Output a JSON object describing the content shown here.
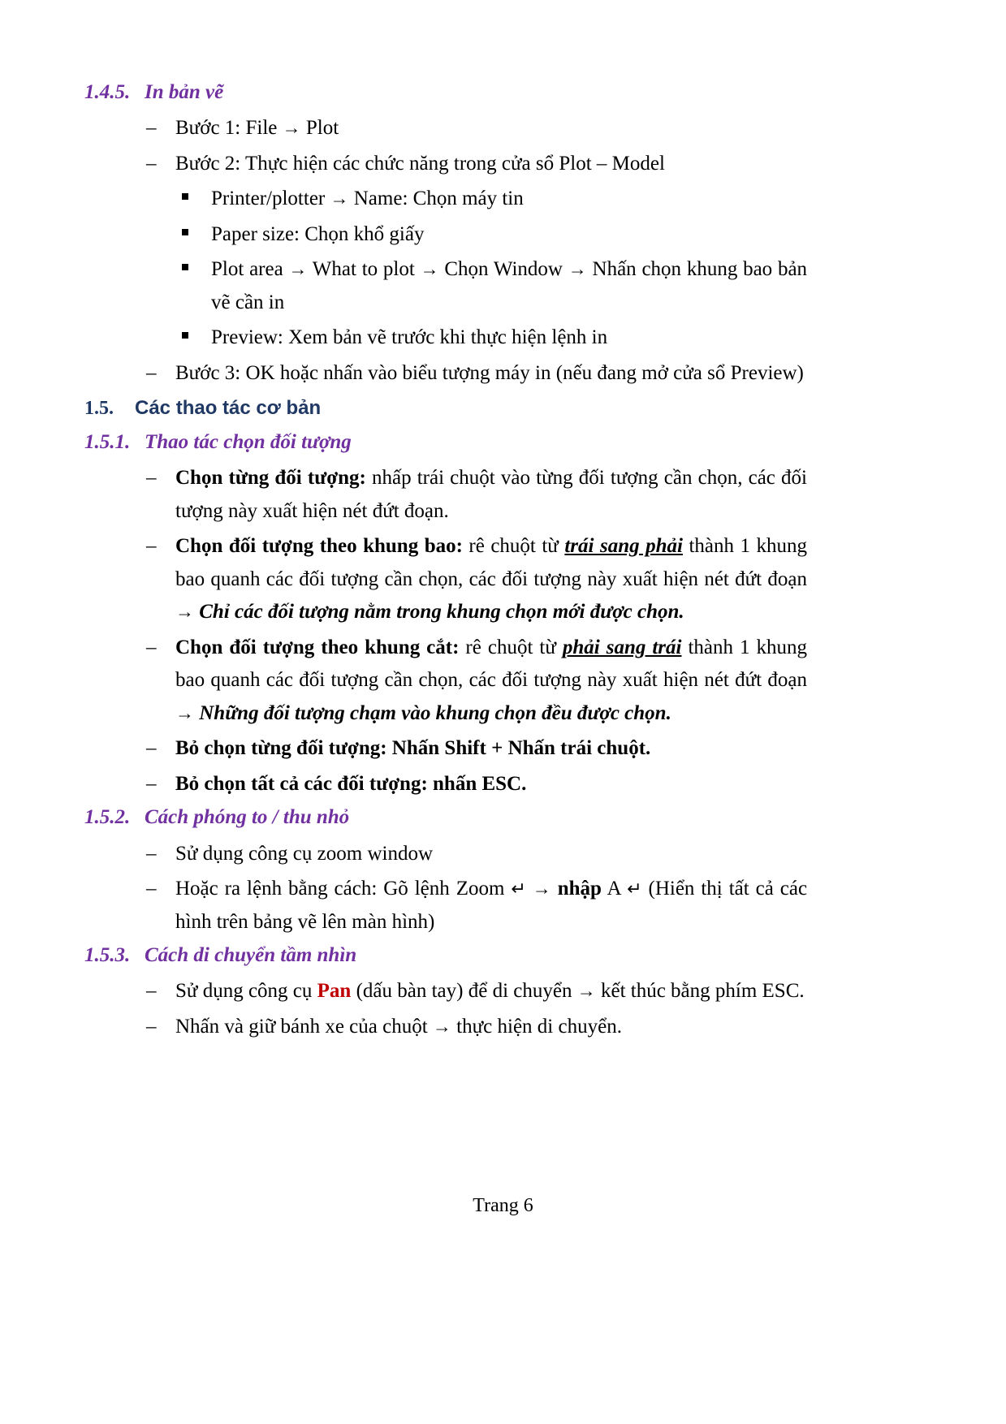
{
  "document": {
    "language": "vi",
    "footer": "Trang 6",
    "colors": {
      "heading3": "#7030A0",
      "heading2": "#1F3864",
      "accent_red": "#C00000",
      "body": "#000000"
    }
  },
  "sections": {
    "s145": {
      "number": "1.4.5.",
      "title": "In bản vẽ",
      "items": {
        "buoc1": {
          "marker": "–",
          "text": "Bước 1: File",
          "arrow": "→",
          "text_after": "Plot"
        },
        "buoc2": {
          "marker": "–",
          "text": "Bước 2: Thực hiện các chức năng trong cửa sổ Plot – Model"
        },
        "sub": [
          {
            "marker": "▪",
            "part1": "Printer/plotter",
            "arrow": "→",
            "part2": "Name: Chọn máy tin"
          },
          {
            "marker": "▪",
            "part1": "Paper size: Chọn khổ giấy"
          },
          {
            "marker": "▪",
            "part1": "Plot area",
            "arrow": "→",
            "part2": "What to plot",
            "arrow2": "→",
            "part3": "Chọn Window",
            "arrow3": "→",
            "part4": "Nhấn chọn khung bao bản vẽ cần in"
          },
          {
            "marker": "▪",
            "part1": "Preview: Xem bản vẽ trước khi thực hiện lệnh in"
          }
        ],
        "buoc3": {
          "marker": "–",
          "text": "Bước 3: OK hoặc nhấn vào biểu tượng máy in (nếu đang mở cửa sổ Preview)"
        }
      }
    },
    "s15": {
      "number": "1.5.",
      "title": "Các thao tác cơ bản"
    },
    "s151": {
      "number": "1.5.1.",
      "title": "Thao tác chọn đối tượng",
      "items": [
        {
          "marker": "–",
          "lead": "Chọn từng đối tượng:",
          "rest": " nhấp trái chuột vào từng đối tượng cần chọn, các đối tượng này xuất hiện nét đứt đoạn."
        },
        {
          "marker": "–",
          "lead": "Chọn đối tượng theo khung bao:",
          "mid1": " rê chuột từ ",
          "emph": "trái sang phải",
          "mid2": " thành 1 khung bao quanh các đối tượng cần chọn, các đối tượng này xuất hiện nét đứt đoạn ",
          "arrow": "→",
          "tail": "Chỉ các đối tượng nằm trong khung chọn mới được chọn."
        },
        {
          "marker": "–",
          "lead": "Chọn đối tượng theo khung cắt:",
          "mid1": " rê chuột từ ",
          "emph": "phải sang trái",
          "mid2": " thành 1 khung bao quanh các đối tượng cần chọn, các đối tượng này xuất hiện nét đứt đoạn ",
          "arrow": "→",
          "tail": "Những đối tượng chạm vào khung chọn đều được chọn."
        },
        {
          "marker": "–",
          "lead": "Bỏ chọn từng đối tượng: Nhấn Shift + Nhấn trái chuột."
        },
        {
          "marker": "–",
          "lead": "Bỏ chọn tất cả các đối tượng: nhấn ESC."
        }
      ]
    },
    "s152": {
      "number": "1.5.2.",
      "title": "Cách phóng to / thu nhỏ",
      "items": [
        {
          "marker": "–",
          "text": "Sử dụng công cụ zoom window"
        },
        {
          "marker": "–",
          "p1": "Hoặc ra lệnh bằng cách: Gõ lệnh Zoom ",
          "enter1": "↵",
          "arrow": "→",
          "bold": "nhập",
          "p2": " A ",
          "enter2": "↵",
          "p3": " (Hiển thị tất cả các hình trên bảng vẽ lên màn hình)"
        }
      ]
    },
    "s153": {
      "number": "1.5.3.",
      "title": "Cách di chuyển tầm nhìn",
      "items": [
        {
          "marker": "–",
          "p1": "Sử dụng công cụ ",
          "red": "Pan",
          "p2": " (dấu bàn tay) để di chuyển ",
          "arrow": "→",
          "p3": "kết thúc bằng phím ESC."
        },
        {
          "marker": "–",
          "p1": "Nhấn và giữ bánh xe của chuột ",
          "arrow": "→",
          "p3": "thực hiện di chuyển."
        }
      ]
    }
  }
}
